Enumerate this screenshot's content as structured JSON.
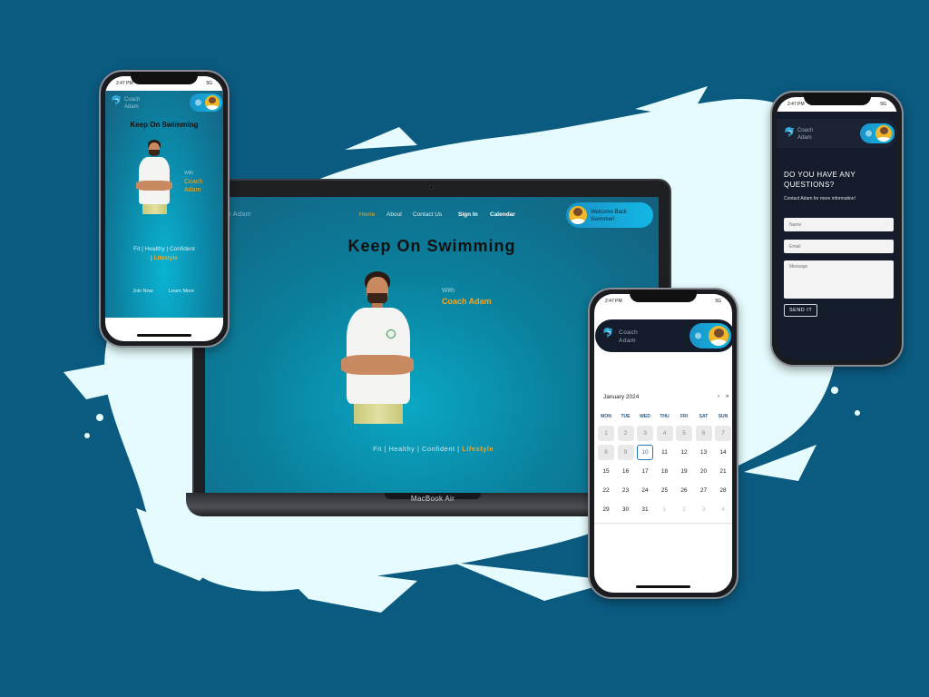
{
  "colors": {
    "background": "#0b5a80",
    "splash": "#e6fbfd",
    "accent": "#f5a623",
    "teal": "#0a8fb0",
    "dark_panel": "#141b2a"
  },
  "laptop": {
    "brand_label": "MacBook Air",
    "site": {
      "logo": "Coach Adam",
      "nav": {
        "home": "Home",
        "about": "About",
        "contact": "Contact Us",
        "signin": "Sign In",
        "calendar": "Calendar"
      },
      "welcome": "Welcome Back Swimmer!",
      "hero_title": "Keep On Swimming",
      "with": "With",
      "coach": "Coach Adam",
      "tagline_main": "Fit | Healthy | Confident |",
      "tagline_accent": "Lifestyle"
    }
  },
  "phone_home": {
    "time": "2:47 PM",
    "signal": "5G",
    "logo_line1": "Coach",
    "logo_line2": "Adam",
    "title": "Keep On Swimming",
    "with": "With",
    "coach_line1": "Coach",
    "coach_line2": "Adam",
    "tagline_main": "Fit | Healthy | Confident",
    "tagline_sep": "|",
    "tagline_accent": "Lifestyle",
    "join": "Join Now",
    "learn": "Learn More"
  },
  "phone_calendar": {
    "time": "2:47 PM",
    "signal": "5G",
    "logo_line1": "Coach",
    "logo_line2": "Adam",
    "month": "January 2024",
    "nav_next": "›",
    "nav_last": "»",
    "dow": [
      "MON",
      "TUE",
      "WED",
      "THU",
      "FRI",
      "SAT",
      "SUN"
    ],
    "weeks": [
      [
        "1",
        "2",
        "3",
        "4",
        "5",
        "6",
        "7"
      ],
      [
        "8",
        "9",
        "10",
        "11",
        "12",
        "13",
        "14"
      ],
      [
        "15",
        "16",
        "17",
        "18",
        "19",
        "20",
        "21"
      ],
      [
        "22",
        "23",
        "24",
        "25",
        "26",
        "27",
        "28"
      ],
      [
        "29",
        "30",
        "31",
        "1",
        "2",
        "3",
        "4"
      ]
    ]
  },
  "phone_contact": {
    "time": "2:47 PM",
    "signal": "5G",
    "logo_line1": "Coach",
    "logo_line2": "Adam",
    "heading": "DO YOU HAVE ANY QUESTIONS?",
    "subtext": "Contact Adam for more information!",
    "name_placeholder": "Name",
    "email_placeholder": "Email",
    "message_placeholder": "Message",
    "send": "SEND IT"
  }
}
